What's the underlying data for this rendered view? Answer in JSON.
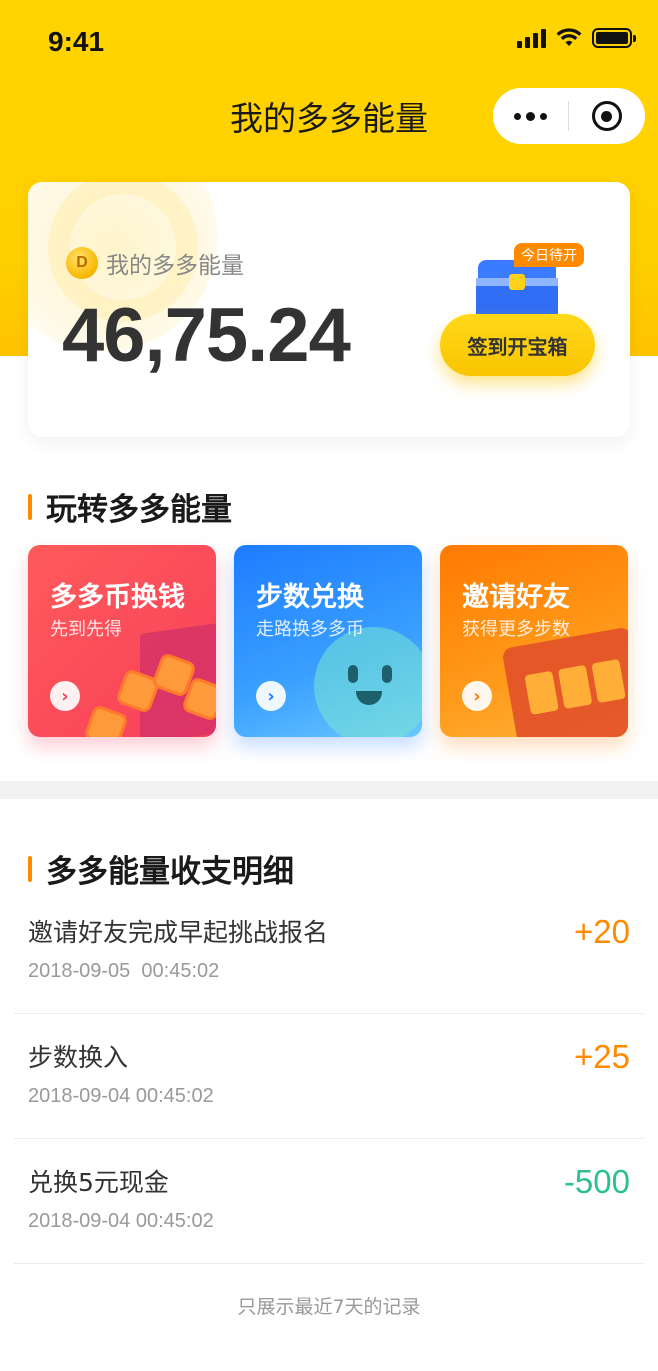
{
  "status_bar": {
    "time": "9:41"
  },
  "nav": {
    "title": "我的多多能量"
  },
  "energy_card": {
    "label": "我的多多能量",
    "coin_letter": "D",
    "value": "46,75.24",
    "badge": "今日待开",
    "sign_button": "签到开宝箱"
  },
  "play_section": {
    "title": "玩转多多能量",
    "cards": [
      {
        "title": "多多币换钱",
        "subtitle": "先到先得"
      },
      {
        "title": "步数兑换",
        "subtitle": "走路换多多币"
      },
      {
        "title": "邀请好友",
        "subtitle": "获得更多步数"
      }
    ],
    "arrow_glyph": "›"
  },
  "detail_section": {
    "title": "多多能量收支明细",
    "records": [
      {
        "title": "邀请好友完成早起挑战报名",
        "time": "2018-09-05  00:45:02",
        "amount": "+20"
      },
      {
        "title": "步数换入",
        "time": "2018-09-04 00:45:02",
        "amount": "+25"
      },
      {
        "title": "兑换5元现金",
        "time": "2018-09-04 00:45:02",
        "amount": "-500"
      }
    ]
  },
  "footer": {
    "note": "只展示最近7天的记录"
  },
  "colors": {
    "header_yellow": "#ffd400",
    "accent_orange": "#ff8a00",
    "minus_green": "#2fbf8f"
  }
}
